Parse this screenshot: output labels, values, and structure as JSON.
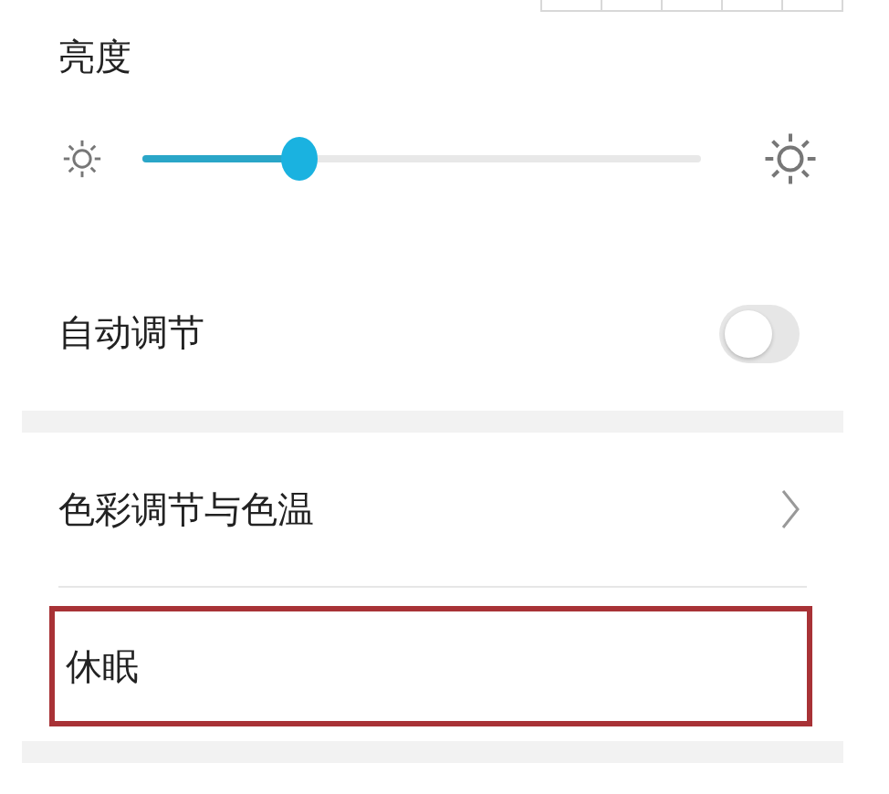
{
  "brightness": {
    "title": "亮度",
    "level": 0.28
  },
  "auto_adjust": {
    "label": "自动调节",
    "on": false
  },
  "items": [
    {
      "label": "色彩调节与色温",
      "kind": "link",
      "highlighted": false
    },
    {
      "label": "休眠",
      "kind": "plain",
      "highlighted": true
    }
  ]
}
